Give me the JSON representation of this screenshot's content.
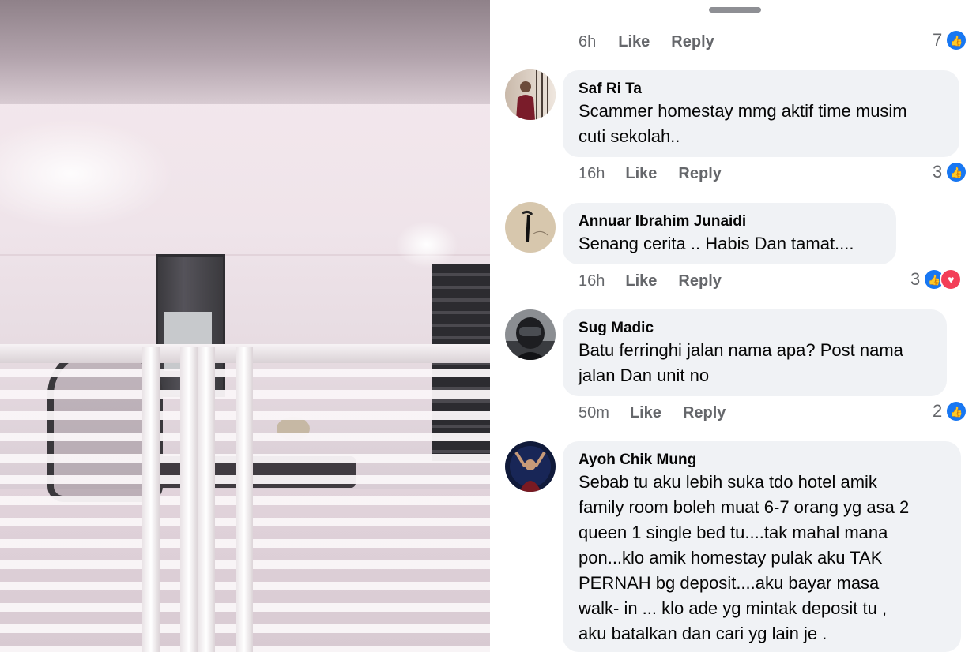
{
  "comments_panel": {
    "top_meta": {
      "time": "6h",
      "like": "Like",
      "reply": "Reply",
      "reaction_count": "7"
    },
    "comments": [
      {
        "author": "Saf Ri Ta",
        "text_lines": [
          "Scammer homestay mmg aktif time musim",
          "cuti sekolah.."
        ],
        "time": "16h",
        "like": "Like",
        "reply": "Reply",
        "reaction_count": "3",
        "reactions": [
          "like-icon"
        ]
      },
      {
        "author": "Annuar Ibrahim Junaidi",
        "text_lines": [
          "Senang cerita .. Habis Dan tamat...."
        ],
        "time": "16h",
        "like": "Like",
        "reply": "Reply",
        "reaction_count": "3",
        "reactions": [
          "like-icon",
          "love-icon"
        ]
      },
      {
        "author": "Sug Madic",
        "text_lines": [
          "Batu ferringhi jalan nama apa? Post nama",
          "jalan Dan unit no"
        ],
        "time": "50m",
        "like": "Like",
        "reply": "Reply",
        "reaction_count": "2",
        "reactions": [
          "like-icon"
        ]
      },
      {
        "author": "Ayoh Chik Mung",
        "text_lines": [
          "Sebab tu aku lebih suka tdo hotel amik",
          "family room boleh muat 6-7 orang yg asa 2",
          "queen 1 single bed tu....tak mahal mana",
          "pon...klo amik homestay pulak aku TAK",
          "PERNAH bg deposit....aku bayar masa",
          "walk- in ... klo ade yg mintak deposit tu ,",
          "aku batalkan dan cari yg lain je ."
        ]
      }
    ],
    "colors": {
      "like_blue": "#1877f2",
      "love_red": "#f33e58",
      "bubble_bg": "#f0f2f5",
      "meta_gray": "#65676b"
    }
  }
}
